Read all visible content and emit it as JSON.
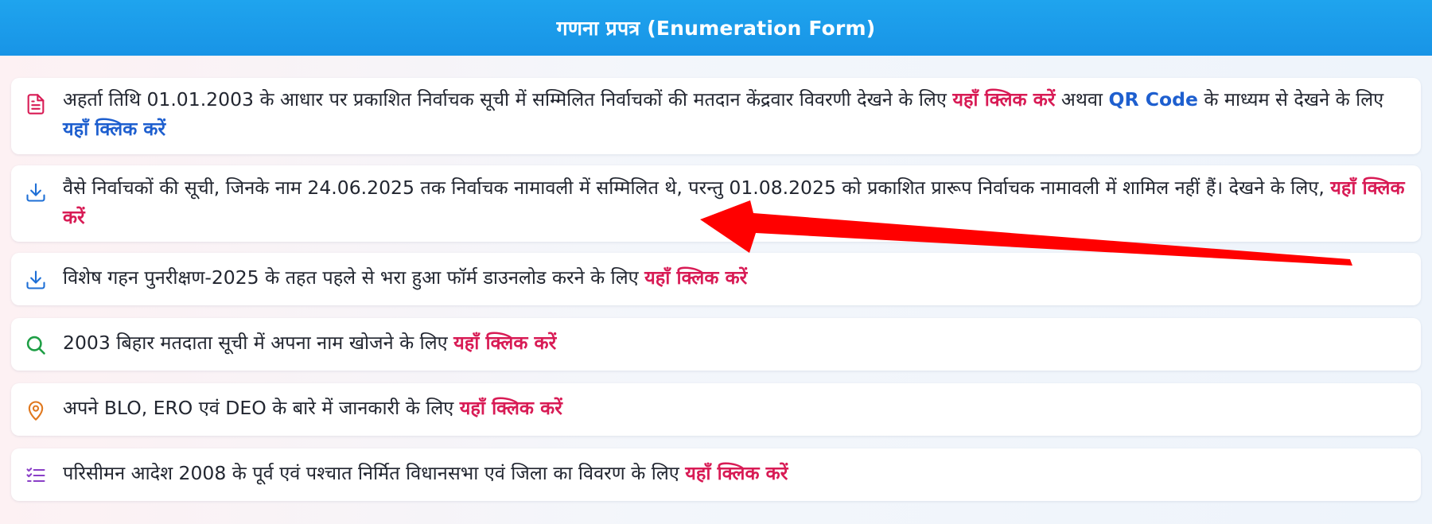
{
  "header": {
    "title": "गणना प्रपत्र (Enumeration Form)"
  },
  "colors": {
    "header_blue": "#1a9bea",
    "link_red": "#d81b55",
    "link_blue": "#1e5fcf",
    "annotation_arrow": "#ff0000"
  },
  "items": [
    {
      "icon": "document-icon",
      "text_1": "अहर्ता तिथि 01.01.2003 के आधार पर प्रकाशित निर्वाचक सूची में सम्मिलित निर्वाचकों की मतदान केंद्रवार विवरणी देखने के लिए ",
      "link_1": "यहाँ क्लिक करें",
      "text_2": " अथवा ",
      "link_qr": "QR Code",
      "text_3": " के माध्यम से देखने के लिए ",
      "link_2": "यहाँ क्लिक करें"
    },
    {
      "icon": "download-icon",
      "text_1": "वैसे निर्वाचकों की सूची, जिनके नाम 24.06.2025 तक निर्वाचक नामावली में सम्मिलित थे, परन्तु 01.08.2025 को प्रकाशित प्रारूप निर्वाचक नामावली में शामिल नहीं हैं। देखने के लिए, ",
      "link_1": "यहाँ क्लिक करें"
    },
    {
      "icon": "download-icon",
      "text_1": "विशेष गहन पुनरीक्षण-2025 के तहत पहले से भरा हुआ फॉर्म डाउनलोड करने के लिए ",
      "link_1": "यहाँ क्लिक करें"
    },
    {
      "icon": "search-icon",
      "text_1": "2003 बिहार मतदाता सूची में अपना नाम खोजने के लिए ",
      "link_1": "यहाँ क्लिक करें"
    },
    {
      "icon": "location-pin-icon",
      "text_1": "अपने BLO, ERO एवं DEO के बारे में जानकारी के लिए ",
      "link_1": "यहाँ क्लिक करें"
    },
    {
      "icon": "list-icon",
      "text_1": "परिसीमन आदेश 2008 के पूर्व एवं पश्चात निर्मित विधानसभा एवं जिला का विवरण के लिए ",
      "link_1": "यहाँ क्लिक करें"
    }
  ]
}
